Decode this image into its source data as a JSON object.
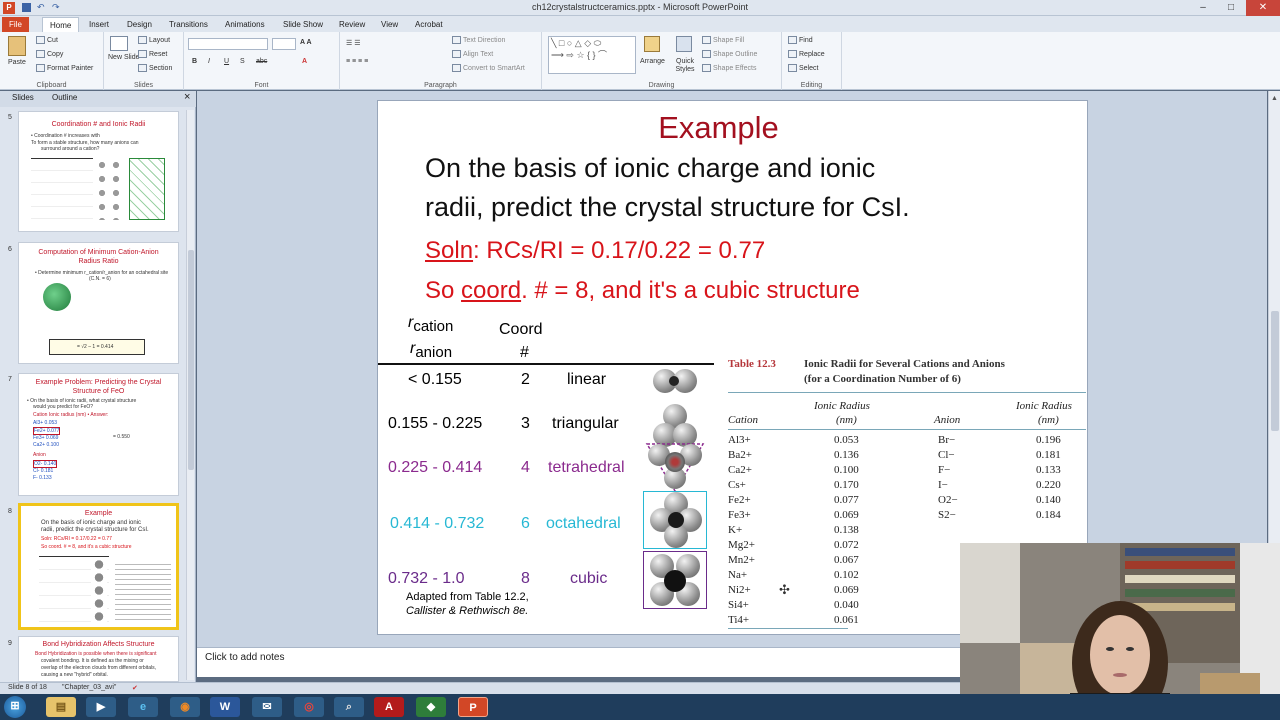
{
  "window": {
    "title": "ch12crystalstructceramics.pptx - Microsoft PowerPoint",
    "minimize": "–",
    "maximize": "□",
    "close": "✕"
  },
  "ribbon_tabs": [
    "File",
    "Home",
    "Insert",
    "Design",
    "Transitions",
    "Animations",
    "Slide Show",
    "Review",
    "View",
    "Acrobat"
  ],
  "ribbon": {
    "clipboard": {
      "label": "Clipboard",
      "paste": "Paste",
      "cut": "Cut",
      "copy": "Copy",
      "format_painter": "Format Painter"
    },
    "slides": {
      "label": "Slides",
      "new_slide": "New Slide",
      "layout": "Layout",
      "reset": "Reset",
      "section": "Section"
    },
    "font": {
      "label": "Font"
    },
    "paragraph": {
      "label": "Paragraph",
      "text_direction": "Text Direction",
      "align_text": "Align Text",
      "convert": "Convert to SmartArt"
    },
    "drawing": {
      "label": "Drawing",
      "arrange": "Arrange",
      "quick_styles": "Quick Styles",
      "shape_fill": "Shape Fill",
      "shape_outline": "Shape Outline",
      "shape_effects": "Shape Effects"
    },
    "editing": {
      "label": "Editing",
      "find": "Find",
      "replace": "Replace",
      "select": "Select"
    }
  },
  "pane_tabs": {
    "slides": "Slides",
    "outline": "Outline",
    "close": "×"
  },
  "thumbnails": [
    {
      "num": "5",
      "title": "Coordination # and Ionic Radii",
      "lines": [
        "• Coordination # increases with",
        "To form a stable structure, how many anions can",
        "surround around a cation?"
      ]
    },
    {
      "num": "6",
      "title": "Computation of Minimum Cation-Anion Radius Ratio",
      "lines": [
        "• Determine minimum r_cation/r_anion for an octahedral site",
        "(C.N. = 6)",
        "= √2 – 1 = 0.414"
      ]
    },
    {
      "num": "7",
      "title": "Example Problem: Predicting the Crystal Structure of FeO",
      "lines": [
        "• On the basis of ionic radii, what crystal structure",
        "would you predict for FeO?",
        "Cation   Ionic radius (nm)   • Answer:",
        "Al3+  0.053",
        "Fe2+  0.077",
        "Fe3+  0.069",
        "Ca2+  0.100",
        "Anion",
        "O2-  0.140",
        "Cl-  0.181",
        "F-  0.133",
        "= 0.550"
      ]
    },
    {
      "num": "8",
      "title": "Example",
      "lines": [
        "On the basis of ionic charge and ionic",
        "radii, predict the crystal structure for CsI.",
        "Soln: RCs/RI = 0.17/0.22 = 0.77",
        "So coord. # = 8, and it's a cubic structure"
      ]
    },
    {
      "num": "9",
      "title": "Bond Hybridization Affects Structure",
      "lines": [
        "Bond Hybridization is possible when there is significant",
        "covalent bonding. It is defined as the mixing or",
        "overlap of the electron clouds from different orbitals,",
        "causing a new \"hybrid\" orbital."
      ]
    }
  ],
  "slide": {
    "title": "Example",
    "body_line1": "On the basis of ionic charge and ionic",
    "body_line2": "radii, predict the crystal structure for CsI.",
    "soln_prefix": "Soln",
    "soln_rest": ": RCs/RI = 0.17/0.22 = 0.77",
    "so_prefix": "So ",
    "so_coord": "coord",
    "so_rest": ". # = 8, and it's a cubic structure",
    "ratio_header_top": "r",
    "ratio_header_top_sub": "cation",
    "ratio_header_bottom": "r",
    "ratio_header_bottom_sub": "anion",
    "coord_header_1": "Coord",
    "coord_header_2": "#",
    "rows": [
      {
        "range": "< 0.155",
        "coord": "2",
        "geometry": "linear",
        "color": "#111111"
      },
      {
        "range": "0.155 - 0.225",
        "coord": "3",
        "geometry": "triangular",
        "color": "#111111"
      },
      {
        "range": "0.225 - 0.414",
        "coord": "4",
        "geometry": "tetrahedral",
        "color": "#8b2a8e"
      },
      {
        "range": "0.414 - 0.732",
        "coord": "6",
        "geometry": "octahedral",
        "color": "#27b8d4"
      },
      {
        "range": "0.732 - 1.0",
        "coord": "8",
        "geometry": "cubic",
        "color": "#6a2b8a"
      }
    ],
    "adapted_1": "Adapted from Table 12.2,",
    "adapted_2": "Callister & Rethwisch 8e.",
    "table": {
      "caption_label": "Table 12.3",
      "caption_1": "Ionic Radii for Several Cations and Anions",
      "caption_2": "(for a Coordination Number of 6)",
      "col_cation": "Cation",
      "col_radius_1": "Ionic Radius",
      "col_radius_2": "(nm)",
      "col_anion": "Anion",
      "cations": [
        [
          "Al3+",
          "0.053"
        ],
        [
          "Ba2+",
          "0.136"
        ],
        [
          "Ca2+",
          "0.100"
        ],
        [
          "Cs+",
          "0.170"
        ],
        [
          "Fe2+",
          "0.077"
        ],
        [
          "Fe3+",
          "0.069"
        ],
        [
          "K+",
          "0.138"
        ],
        [
          "Mg2+",
          "0.072"
        ],
        [
          "Mn2+",
          "0.067"
        ],
        [
          "Na+",
          "0.102"
        ],
        [
          "Ni2+",
          "0.069"
        ],
        [
          "Si4+",
          "0.040"
        ],
        [
          "Ti4+",
          "0.061"
        ]
      ],
      "anions": [
        [
          "Br−",
          "0.196"
        ],
        [
          "Cl−",
          "0.181"
        ],
        [
          "F−",
          "0.133"
        ],
        [
          "I−",
          "0.220"
        ],
        [
          "O2−",
          "0.140"
        ],
        [
          "S2−",
          "0.184"
        ]
      ]
    }
  },
  "notes_placeholder": "Click to add notes",
  "status": {
    "slide": "Slide 8 of 18",
    "theme": "\"Chapter_03_avi\""
  },
  "taskbar_apps": [
    "start",
    "explorer",
    "media",
    "ie",
    "firefox",
    "word",
    "thunderbird",
    "chrome",
    "search",
    "acrobat",
    "maps",
    "powerpoint"
  ]
}
